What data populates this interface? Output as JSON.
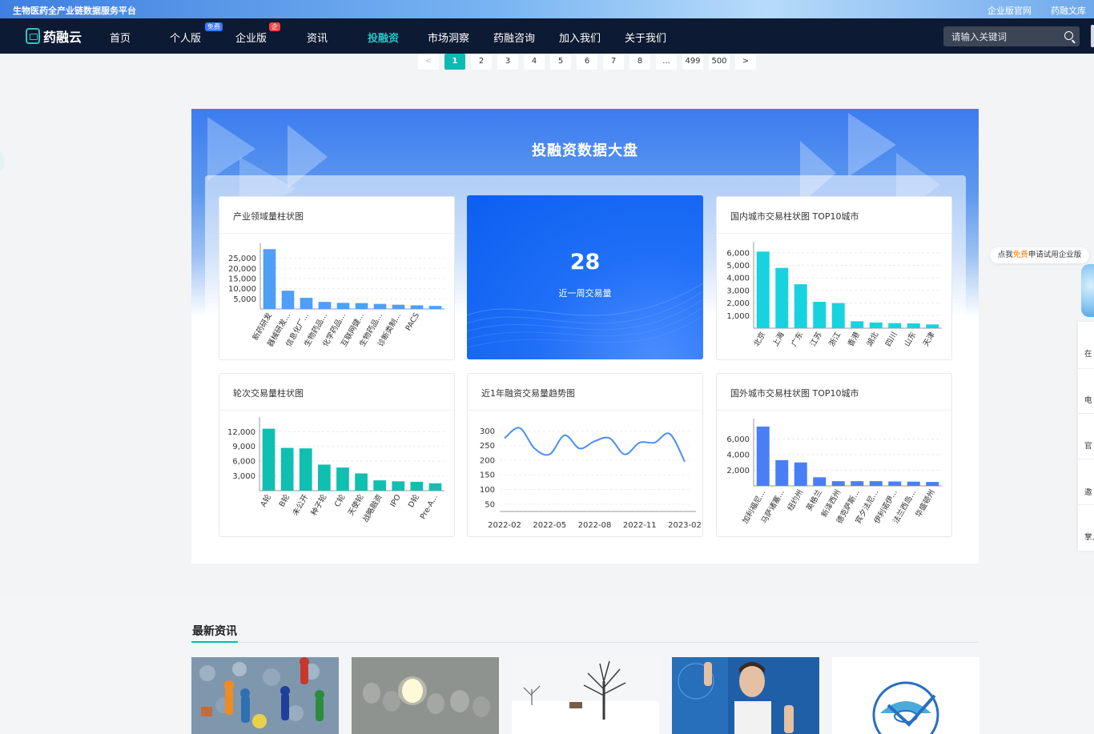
{
  "topbar": {
    "tagline": "生物医药全产业链数据服务平台",
    "links": [
      "企业版官网",
      "药融文库"
    ]
  },
  "nav": {
    "logo": "药融云",
    "items": [
      {
        "label": "首页"
      },
      {
        "label": "个人版",
        "badge": "免费"
      },
      {
        "label": "企业版",
        "badge": "企"
      },
      {
        "label": "资讯"
      },
      {
        "label": "投融资",
        "active": true
      },
      {
        "label": "市场洞察"
      },
      {
        "label": "药融咨询"
      },
      {
        "label": "加入我们"
      },
      {
        "label": "关于我们"
      }
    ],
    "search_placeholder": "请输入关键词"
  },
  "pagination": {
    "prev": "<",
    "next": ">",
    "pages": [
      "1",
      "2",
      "3",
      "4",
      "5",
      "6",
      "7",
      "8",
      "...",
      "499",
      "500"
    ],
    "current": "1"
  },
  "dashboard": {
    "title": "投融资数据大盘",
    "stat": {
      "value": "28",
      "label": "近一周交易量"
    },
    "accent_color": "#10b9b4"
  },
  "chart_data": [
    {
      "id": "industry",
      "type": "bar",
      "title": "产业领域量柱状图",
      "color": "#4e9ff5",
      "categories": [
        "新药研发",
        "器械研发...",
        "信息化厂...",
        "生物药品...",
        "化学药品...",
        "互联网健...",
        "生物药品...",
        "诊断类制...",
        "PACS",
        ""
      ],
      "values": [
        29500,
        9000,
        5500,
        3500,
        3000,
        2900,
        2500,
        2100,
        1800,
        1500
      ],
      "ylim": [
        0,
        30000
      ],
      "yticks": [
        5000,
        10000,
        15000,
        20000,
        25000
      ],
      "ytick_labels": [
        "5,000",
        "10,000",
        "15,000",
        "20,000",
        "25,000"
      ]
    },
    {
      "id": "domestic",
      "type": "bar",
      "title": "国内城市交易柱状图 TOP10城市",
      "color": "#17d3e0",
      "categories": [
        "北京",
        "上海",
        "广东",
        "江苏",
        "浙江",
        "香港",
        "湖北",
        "四川",
        "山东",
        "天津"
      ],
      "values": [
        6100,
        4800,
        3500,
        2100,
        2000,
        550,
        450,
        400,
        380,
        300
      ],
      "ylim": [
        0,
        6500
      ],
      "yticks": [
        1000,
        2000,
        3000,
        4000,
        5000,
        6000
      ],
      "ytick_labels": [
        "1,000",
        "2,000",
        "3,000",
        "4,000",
        "5,000",
        "6,000"
      ]
    },
    {
      "id": "rounds",
      "type": "bar",
      "title": "轮次交易量柱状图",
      "color": "#0fbfb0",
      "categories": [
        "A轮",
        "B轮",
        "未公开",
        "种子轮",
        "C轮",
        "天使轮",
        "战略融资",
        "IPO",
        "D轮",
        "Pre-A..."
      ],
      "values": [
        12600,
        8700,
        8600,
        5300,
        4700,
        3500,
        2100,
        1900,
        1800,
        1500
      ],
      "ylim": [
        0,
        14000
      ],
      "yticks": [
        3000,
        6000,
        9000,
        12000
      ],
      "ytick_labels": [
        "3,000",
        "6,000",
        "9,000",
        "12,000"
      ]
    },
    {
      "id": "trend",
      "type": "line",
      "title": "近1年融资交易量趋势图",
      "color": "#4c8df5",
      "x": [
        "2022-02",
        "",
        "",
        "2022-05",
        "",
        "",
        "2022-08",
        "",
        "",
        "2022-11",
        "",
        "",
        "2023-02"
      ],
      "x_tick_labels": [
        "2022-02",
        "2022-05",
        "2022-08",
        "2022-11",
        "2023-02"
      ],
      "y": [
        275,
        310,
        240,
        220,
        285,
        240,
        265,
        275,
        220,
        260,
        260,
        290,
        195
      ],
      "ylim": [
        25,
        320
      ],
      "yticks": [
        50,
        100,
        150,
        200,
        250,
        300
      ]
    },
    {
      "id": "foreign",
      "type": "bar",
      "title": "国外城市交易柱状图 TOP10城市",
      "color": "#4a7ef5",
      "categories": [
        "加利福尼...",
        "马萨诸塞...",
        "纽约州",
        "英格兰",
        "新泽西州",
        "德克萨斯...",
        "宾夕法尼...",
        "伊利诺伊...",
        "法兰西岛...",
        "华盛顿州"
      ],
      "values": [
        7600,
        3300,
        3000,
        1100,
        600,
        600,
        600,
        560,
        540,
        500
      ],
      "ylim": [
        0,
        8000
      ],
      "yticks": [
        2000,
        4000,
        6000
      ],
      "ytick_labels": [
        "2,000",
        "4,000",
        "6,000"
      ]
    }
  ],
  "float": {
    "trial_pre": "点我",
    "trial_hl": "免费",
    "trial_post": "申请试用企业版",
    "side_items": [
      "在",
      "电",
      "官",
      "邀",
      "掌上"
    ]
  },
  "news": {
    "title": "最新资讯"
  }
}
